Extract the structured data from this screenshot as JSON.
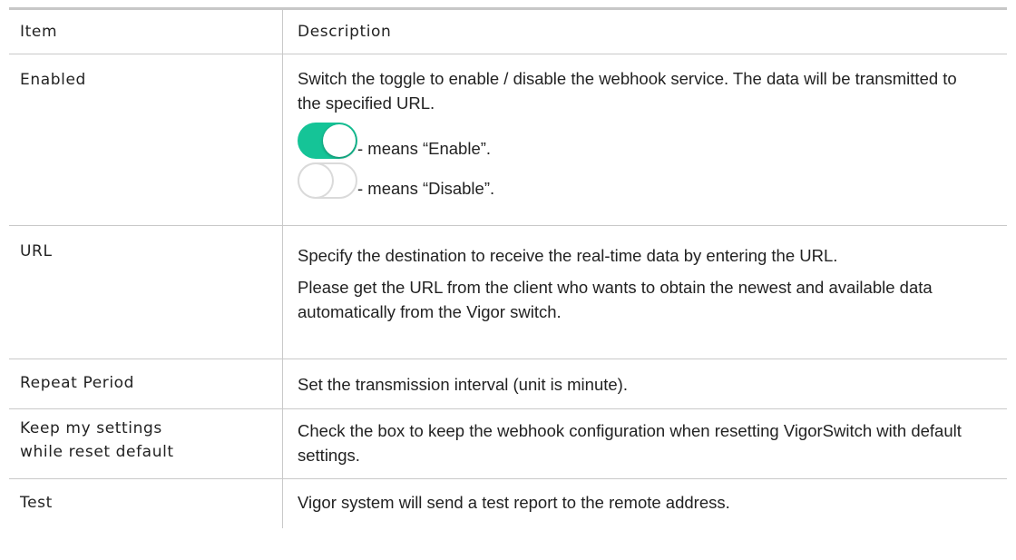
{
  "table": {
    "header": {
      "item": "Item",
      "description": "Description"
    },
    "rows": {
      "enabled": {
        "item": "Enabled",
        "desc": "Switch the toggle to enable / disable the webhook service. The data will be transmitted to the specified URL.",
        "toggle_on_text": "- means “Enable”.",
        "toggle_off_text": "- means “Disable”."
      },
      "url": {
        "item": "URL",
        "desc1": "Specify the destination to receive the real-time data by entering the URL.",
        "desc2": "Please get the URL from the client who wants to obtain the newest and available data automatically from the Vigor switch."
      },
      "repeat": {
        "item": "Repeat Period",
        "desc": "Set the transmission interval (unit is minute)."
      },
      "keep": {
        "item_line1": "Keep my settings",
        "item_line2": "while reset default",
        "desc": "Check the box to keep the webhook configuration when resetting VigorSwitch with default settings."
      },
      "test": {
        "item": "Test",
        "desc": "Vigor system will send a test report to the remote address."
      }
    }
  },
  "colors": {
    "toggle_on": "#15c497",
    "border": "#c9c9c9"
  },
  "icons": {
    "toggle_on": "toggle-on-icon",
    "toggle_off": "toggle-off-icon"
  }
}
